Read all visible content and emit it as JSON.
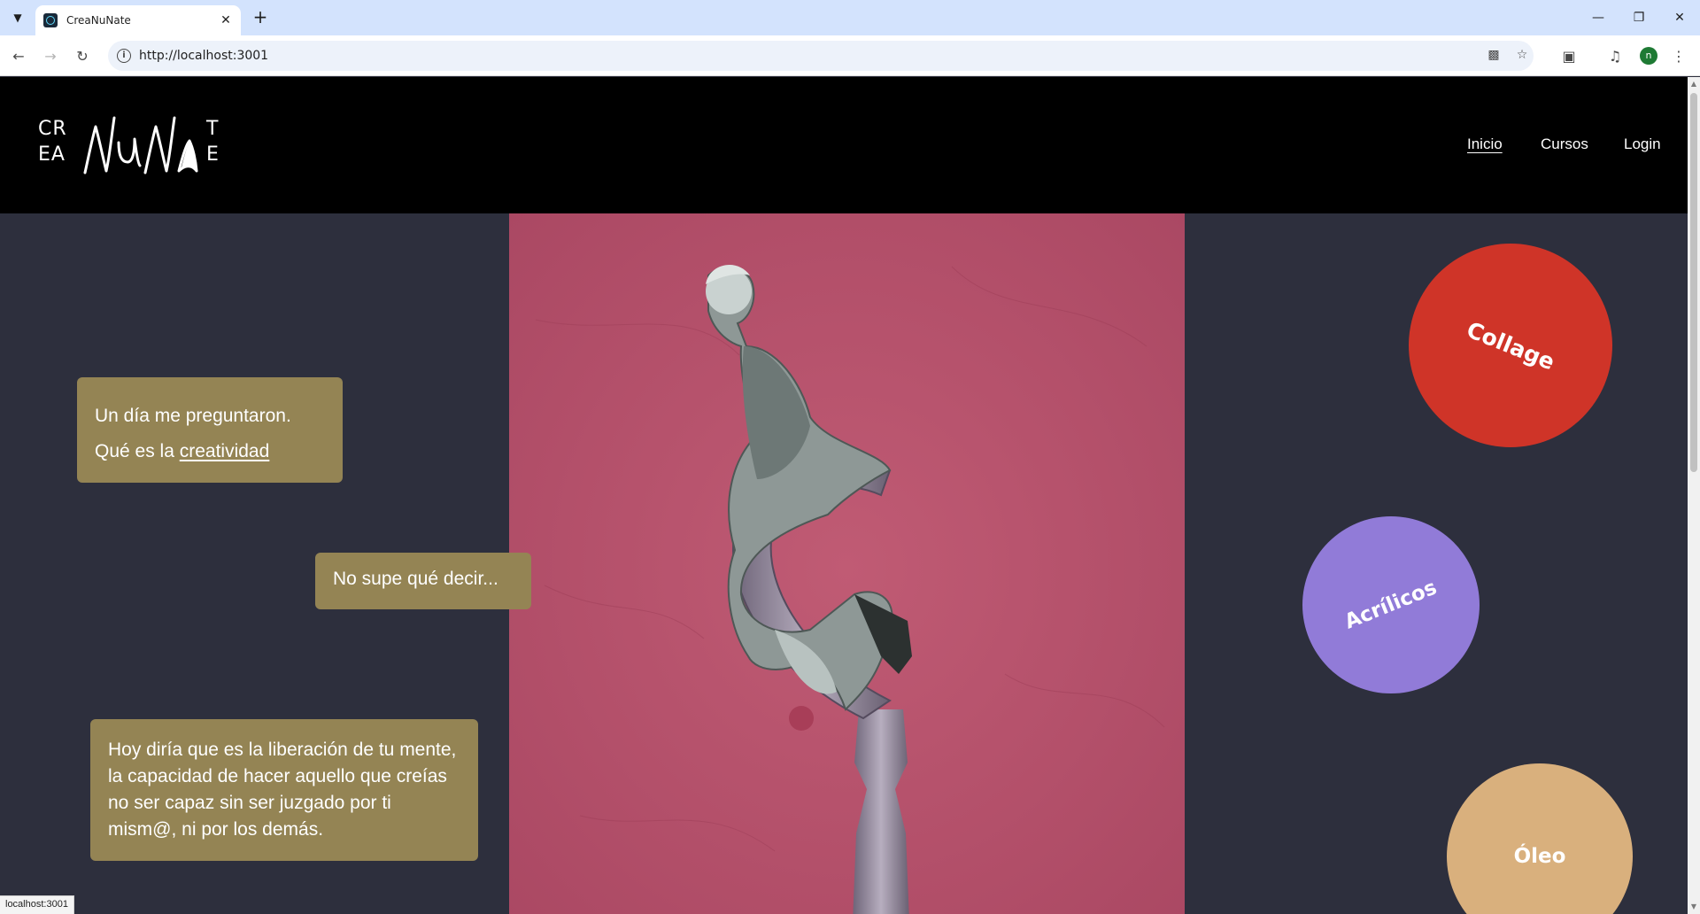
{
  "browser": {
    "tab_title": "CreaNuNate",
    "url": "http://localhost:3001",
    "status_url": "localhost:3001"
  },
  "site": {
    "logo": {
      "left_top": "CR",
      "left_bottom": "EA",
      "right_top": "T",
      "right_bottom": "E",
      "script_text": "NuNa"
    },
    "nav": [
      {
        "label": "Inicio",
        "active": true
      },
      {
        "label": "Cursos",
        "active": false
      },
      {
        "label": "Login",
        "active": false
      }
    ]
  },
  "bubbles": {
    "first_line": "Un día me preguntaron.",
    "second_prefix": "Qué es la ",
    "second_link": "creatividad",
    "second": "No supe qué decir...",
    "third": "Hoy diría que es la liberación de tu mente, la capacidad de hacer aquello que creías no ser capaz sin ser juzgado por ti mism@, ni por los demás."
  },
  "categories": [
    {
      "label": "Collage",
      "color": "#cf3428"
    },
    {
      "label": "Acrílicos",
      "color": "#917bd8"
    },
    {
      "label": "Óleo",
      "color": "#d9b07d"
    }
  ],
  "colors": {
    "page_bg": "#2d2f3d",
    "header_bg": "#000000",
    "bubble_bg": "#948454",
    "artwork_bg": "#b9516b"
  }
}
